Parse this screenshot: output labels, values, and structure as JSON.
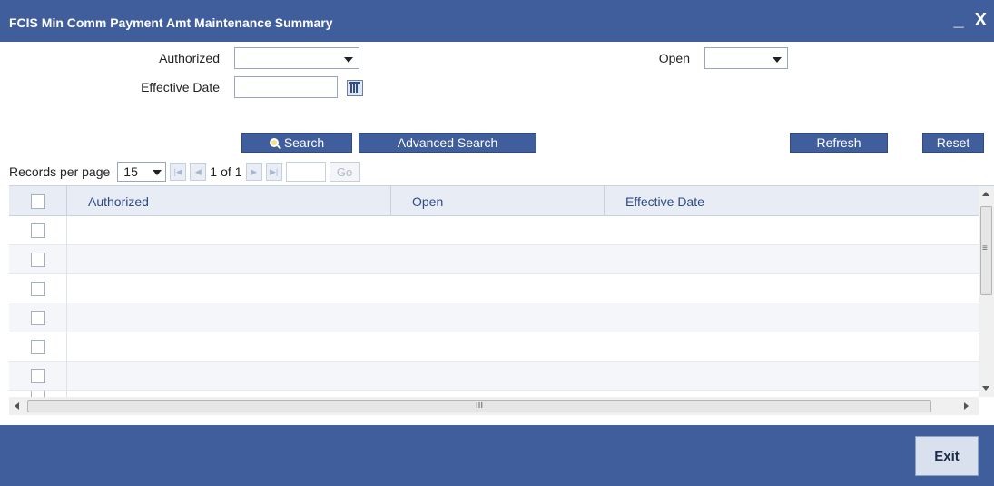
{
  "window": {
    "title": "FCIS Min Comm Payment Amt Maintenance Summary",
    "minimize": "_",
    "close": "X"
  },
  "filters": {
    "authorized_label": "Authorized",
    "authorized_value": "",
    "open_label": "Open",
    "open_value": "",
    "effective_date_label": "Effective Date",
    "effective_date_value": ""
  },
  "actions": {
    "search": "Search",
    "advanced_search": "Advanced Search",
    "refresh": "Refresh",
    "reset": "Reset"
  },
  "pager": {
    "records_per_page_label": "Records per page",
    "records_per_page": "15",
    "current_page": "1",
    "of_label": "of",
    "total_pages": "1",
    "go": "Go"
  },
  "grid": {
    "columns": [
      "Authorized",
      "Open",
      "Effective Date"
    ],
    "empty_rows": 7,
    "hscroll_grip": "III"
  },
  "footer": {
    "exit": "Exit"
  },
  "colors": {
    "accent": "#3f5e9b",
    "header_text": "#2c4a86"
  }
}
